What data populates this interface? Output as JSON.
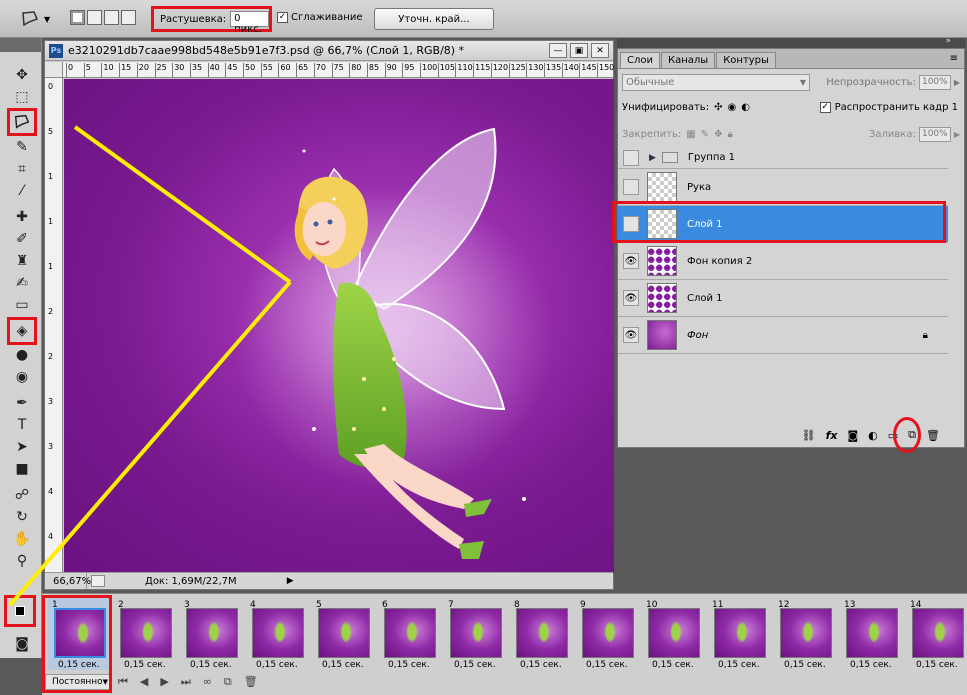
{
  "options_bar": {
    "feather_label": "Растушевка:",
    "feather_value": "0 пикс.",
    "antialias_label": "Сглаживание",
    "refine_edge_label": "Уточн. край..."
  },
  "document": {
    "title": "e3210291db7caae998bd548e5b91e7f3.psd @ 66,7% (Слой 1, RGB/8) *",
    "ps_badge": "Ps",
    "zoom": "66,67%",
    "doc_info": "Док: 1,69M/22,7M",
    "ruler_h_ticks": [
      "0",
      "5",
      "10",
      "15",
      "20",
      "25",
      "30",
      "35",
      "40",
      "45",
      "50",
      "55",
      "60",
      "65",
      "70",
      "75",
      "80",
      "85",
      "90",
      "95",
      "100",
      "105",
      "110",
      "115",
      "120",
      "125",
      "130",
      "135",
      "140",
      "145",
      "150"
    ],
    "ruler_v_ticks": [
      "0",
      "5",
      "1",
      "1",
      "1",
      "2",
      "2",
      "3",
      "3",
      "4",
      "4"
    ]
  },
  "layers_panel": {
    "tabs": [
      "Слои",
      "Каналы",
      "Контуры"
    ],
    "blend_mode": "Обычные",
    "opacity_label": "Непрозрачность:",
    "opacity_value": "100%",
    "unify_label": "Унифицировать:",
    "propagate_label": "Распространить кадр 1",
    "lock_label": "Закрепить:",
    "fill_label": "Заливка:",
    "fill_value": "100%",
    "layers": [
      {
        "name": "Группа 1",
        "type": "group",
        "visible": false
      },
      {
        "name": "Рука",
        "type": "empty",
        "visible": false
      },
      {
        "name": "Слой 1",
        "type": "empty",
        "visible": false,
        "selected": true
      },
      {
        "name": "Фон копия 2",
        "type": "blob",
        "visible": true
      },
      {
        "name": "Слой 1",
        "type": "blob",
        "visible": true
      },
      {
        "name": "Фон",
        "type": "background",
        "visible": true,
        "locked": true
      }
    ]
  },
  "timeline": {
    "frames": [
      {
        "n": "1",
        "delay": "0,15 сек."
      },
      {
        "n": "2",
        "delay": "0,15 сек."
      },
      {
        "n": "3",
        "delay": "0,15 сек."
      },
      {
        "n": "4",
        "delay": "0,15 сек."
      },
      {
        "n": "5",
        "delay": "0,15 сек."
      },
      {
        "n": "6",
        "delay": "0,15 сек."
      },
      {
        "n": "7",
        "delay": "0,15 сек."
      },
      {
        "n": "8",
        "delay": "0,15 сек."
      },
      {
        "n": "9",
        "delay": "0,15 сек."
      },
      {
        "n": "10",
        "delay": "0,15 сек."
      },
      {
        "n": "11",
        "delay": "0,15 сек."
      },
      {
        "n": "12",
        "delay": "0,15 сек."
      },
      {
        "n": "13",
        "delay": "0,15 сек."
      },
      {
        "n": "14",
        "delay": "0,15 сек."
      }
    ],
    "loop": "Постоянно"
  },
  "colors": {
    "highlight_red": "#e3121b",
    "selection_blue": "#3a8be0",
    "annotation_yellow": "#ffee00",
    "canvas_purple": "#7a1a90"
  }
}
